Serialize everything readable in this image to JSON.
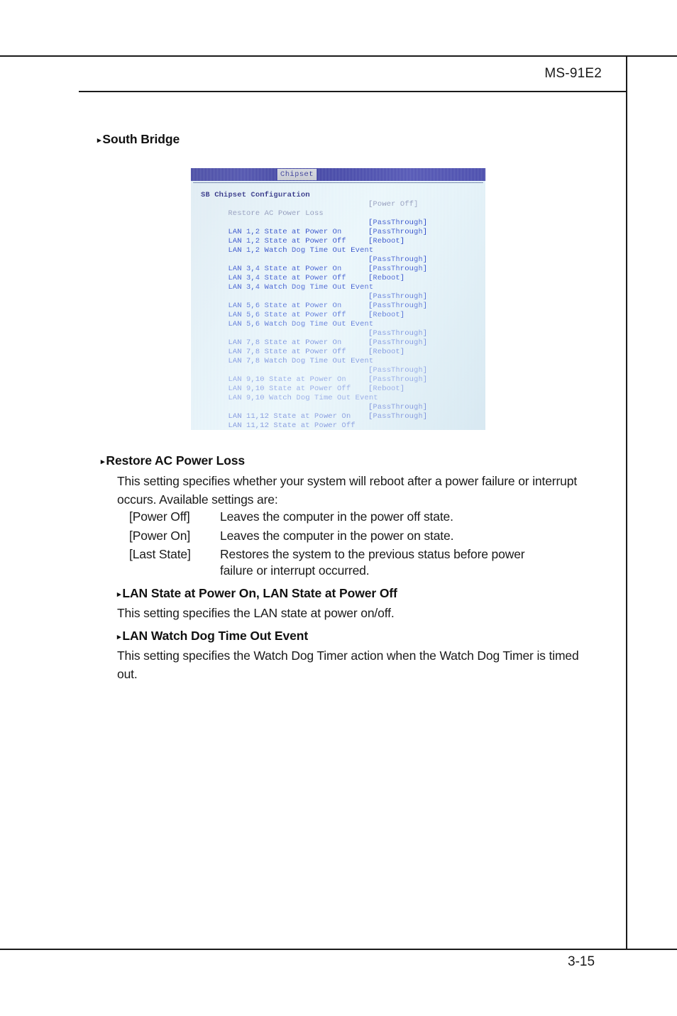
{
  "page": {
    "header_model": "MS-91E2",
    "footer_page_number": "3-15"
  },
  "sections": [
    {
      "heading": "South Bridge",
      "bullet_glyph": "▸"
    },
    {
      "heading": "Restore AC Power Loss",
      "body": "This setting specifies whether your system will reboot after a power failure or interrupt occurs. Available settings are:",
      "options": [
        {
          "key": "[Power Off]",
          "desc": "Leaves the computer in the power off state."
        },
        {
          "key": "[Power On]",
          "desc": "Leaves the computer in the power on state."
        },
        {
          "key": "[Last State]",
          "desc": "Restores the system to the previous status before power",
          "desc_cont": "failure or interrupt occurred."
        }
      ]
    },
    {
      "heading": "LAN State at Power On, LAN State at Power Off",
      "body": "This setting specifies the LAN state at power on/off."
    },
    {
      "heading": "LAN Watch Dog Time Out Event",
      "body": "This setting specifies the Watch Dog Timer action when the Watch Dog Timer is timed out."
    }
  ],
  "bios": {
    "tab_label": "Chipset",
    "title": "SB Chipset Configuration",
    "restore_label": "Restore AC Power Loss",
    "restore_value": "[Power Off]",
    "groups": [
      {
        "rows": [
          {
            "label": "LAN 1,2 State at Power On",
            "value": "[PassThrough]"
          },
          {
            "label": "LAN 1,2 State at Power Off",
            "value": "[PassThrough]"
          },
          {
            "label": "LAN 1,2 Watch Dog Time Out Event",
            "value": "[Reboot]"
          }
        ]
      },
      {
        "rows": [
          {
            "label": "LAN 3,4 State at Power On",
            "value": "[PassThrough]"
          },
          {
            "label": "LAN 3,4 State at Power Off",
            "value": "[PassThrough]"
          },
          {
            "label": "LAN 3,4 Watch Dog Time Out Event",
            "value": "[Reboot]"
          }
        ]
      },
      {
        "rows": [
          {
            "label": "LAN 5,6 State at Power On",
            "value": "[PassThrough]"
          },
          {
            "label": "LAN 5,6 State at Power Off",
            "value": "[PassThrough]"
          },
          {
            "label": "LAN 5,6 Watch Dog Time Out Event",
            "value": "[Reboot]"
          }
        ]
      },
      {
        "rows": [
          {
            "label": "LAN 7,8 State at Power On",
            "value": "[PassThrough]"
          },
          {
            "label": "LAN 7,8 State at Power Off",
            "value": "[PassThrough]"
          },
          {
            "label": "LAN 7,8 Watch Dog Time Out Event",
            "value": "[Reboot]"
          }
        ]
      },
      {
        "rows": [
          {
            "label": "LAN 9,10 State at Power On",
            "value": "[PassThrough]"
          },
          {
            "label": "LAN 9,10 State at Power Off",
            "value": "[PassThrough]"
          },
          {
            "label": "LAN 9,10 Watch Dog Time Out Event",
            "value": "[Reboot]"
          }
        ]
      },
      {
        "rows": [
          {
            "label": "LAN 11,12 State at Power On",
            "value": "[PassThrough]"
          },
          {
            "label": "LAN 11,12 State at Power Off",
            "value": "[PassThrough]"
          }
        ]
      }
    ]
  }
}
